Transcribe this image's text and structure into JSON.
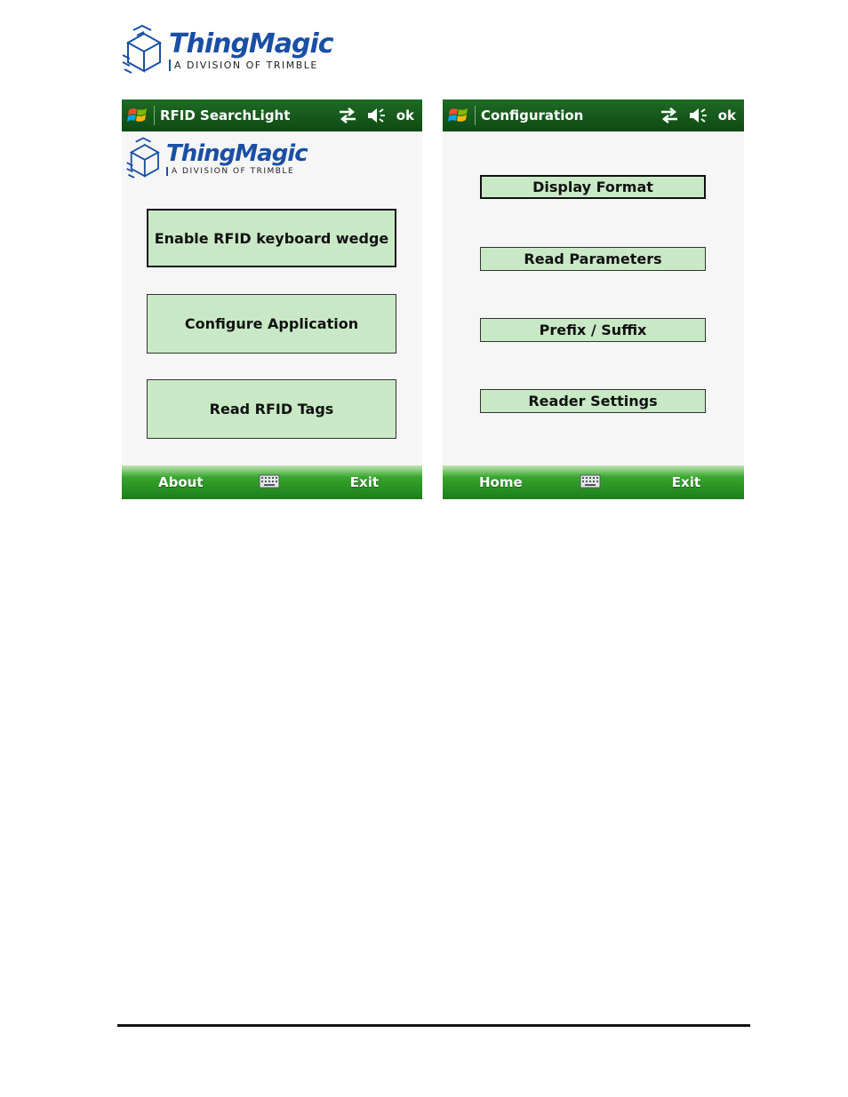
{
  "logo": {
    "name": "ThingMagic",
    "tagline": "A DIVISION OF TRIMBLE"
  },
  "left_screen": {
    "title": "RFID SearchLight",
    "ok": "ok",
    "buttons": {
      "wedge": "Enable RFID keyboard wedge",
      "configure": "Configure Application",
      "read": "Read RFID Tags"
    },
    "softkeys": {
      "left": "About",
      "right": "Exit"
    }
  },
  "right_screen": {
    "title": "Configuration",
    "ok": "ok",
    "buttons": {
      "display": "Display Format",
      "read_params": "Read Parameters",
      "prefix": "Prefix / Suffix",
      "reader": "Reader Settings"
    },
    "softkeys": {
      "left": "Home",
      "right": "Exit"
    }
  },
  "icons": [
    "thingmagic-logo-icon",
    "windows-start-icon",
    "connectivity-icon",
    "speaker-icon",
    "keyboard-icon"
  ],
  "colors": {
    "titlebar": "#1a5e1f",
    "button_fill": "#c9e9c6",
    "softbar": "#2a9326",
    "brand_blue": "#1a4fa5"
  }
}
